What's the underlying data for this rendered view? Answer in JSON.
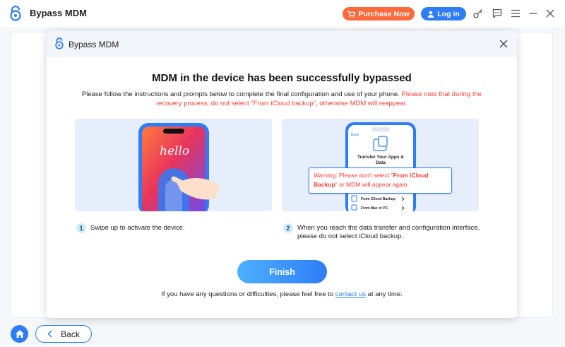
{
  "app": {
    "title": "Bypass MDM",
    "purchase_label": "Purchase Now",
    "login_label": "Log in"
  },
  "dialog": {
    "title": "Bypass MDM",
    "headline": "MDM in the device has been successfully bypassed",
    "description_normal": "Please follow the instructions and prompts below to complete the final configuration and use of your phone.",
    "description_warning": "Please note that during the recovery process, do not select \"From iCloud backup\", otherwise MDM will reappear.",
    "card1": {
      "phone_text": "hello"
    },
    "card2": {
      "back_label": "Back",
      "screen_title": "Transfer Your Apps & Data",
      "warning_prefix": "Warning: Please don't select \"",
      "warning_bold": "From iCloud Backup",
      "warning_suffix": "\" or MDM will appear again.",
      "option_icloud": "From iCloud Backup",
      "option_mac": "From Mac or PC"
    },
    "steps": [
      {
        "number": "1",
        "text": "Swipe up to activate the device."
      },
      {
        "number": "2",
        "text": "When you reach the data transfer and configuration interface, please do not select iCloud backup."
      }
    ],
    "finish_label": "Finish",
    "footer_prefix": "If you have any questions or difficulties, please feel free to",
    "footer_link": "contact us",
    "footer_suffix": "at any time."
  },
  "bottom": {
    "back_label": "Back"
  },
  "colors": {
    "accent": "#2f7df6",
    "purchase": "#ff6a3d",
    "warning": "#ff3b30"
  }
}
